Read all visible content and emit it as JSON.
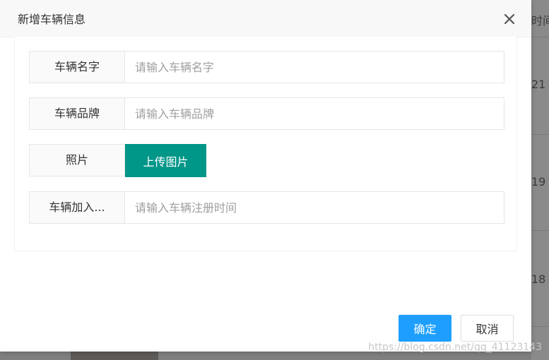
{
  "dialog": {
    "title": "新增车辆信息",
    "close_icon": "close-icon"
  },
  "form": {
    "fields": [
      {
        "label": "车辆名字",
        "placeholder": "请输入车辆名字",
        "value": ""
      },
      {
        "label": "车辆品牌",
        "placeholder": "请输入车辆品牌",
        "value": ""
      },
      {
        "label": "照片",
        "button_label": "上传图片"
      },
      {
        "label": "车辆加入...",
        "placeholder": "请输入车辆注册时间",
        "value": ""
      }
    ]
  },
  "footer": {
    "ok_label": "确定",
    "cancel_label": "取消"
  },
  "background": {
    "header_partial": "时间",
    "row_values": [
      "21",
      "19",
      "18"
    ]
  },
  "watermark": "https://blog.csdn.net/qq_41123143",
  "colors": {
    "upload_button": "#009688",
    "ok_button": "#1e9fff",
    "overlay": "#7f7f7f"
  }
}
